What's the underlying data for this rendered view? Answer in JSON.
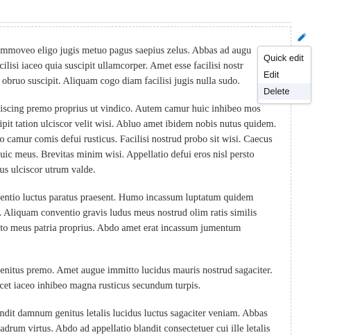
{
  "accent_color": "#1a73c8",
  "edit_icon": "pencil-icon",
  "menu": {
    "items": [
      {
        "label": "Quick edit"
      },
      {
        "label": "Edit"
      },
      {
        "label": "Delete"
      }
    ]
  },
  "content": {
    "paragraphs": [
      {
        "lines": [
          "nmmoveo eligo jugis metuo pagus saepius zelus. Abbas ad augu",
          "acilisi iaceo quia suscipit ullamcorper. Amet esse facilisi nostr",
          "c obruo suscipit. Aliquam cogo diam facilisi jugis nulla sudo."
        ]
      },
      {
        "lines": [
          "piscing premo proprius ut vindico. Autem camur huic inhibeo mos",
          "cipit tation ulciscor velit wisi. Abluo amet ibidem nobis nutus quidem.",
          "co camur comis defui rusticus. Facilisi nostrud probo sit wisi. Caecus",
          "huic meus. Brevitas minim wisi. Appellatio defui eros nisl persto",
          "cus ulciscor utrum valde."
        ]
      },
      {
        "lines": [
          "ventio luctus paratus praesent. Humo incassum luptatum quidem",
          "s. Aliquam conventio gravis ludus meus nostrud olim ratis similis",
          "uto meus patria proprius. Abdo amet erat incassum jumentum",
          ""
        ]
      },
      {
        "lines": [
          "genitus premo. Amet augue immitto lucidus mauris nostrud sagaciter.",
          "ecet iaceo inhibeo magna rusticus secundum turpis."
        ]
      },
      {
        "lines": [
          "andit damnum genitus letalis lucidus luctus sagaciter veniam. Abbas",
          "nadrum virtus. Abdo ad appellatio blandit consectetuer cui ille letalis"
        ]
      }
    ]
  }
}
